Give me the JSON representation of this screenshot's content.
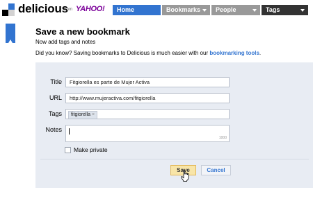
{
  "header": {
    "brand": "delicious",
    "from_label": "from",
    "partner_logo": "YAHOO!",
    "nav": [
      {
        "label": "Home"
      },
      {
        "label": "Bookmarks"
      },
      {
        "label": "People"
      },
      {
        "label": "Tags"
      }
    ]
  },
  "page": {
    "title": "Save a new bookmark",
    "subtitle": "Now add tags and notes",
    "tip_text": "Did you know? Saving bookmarks to Delicious is much easier with our ",
    "tip_link": "bookmarking tools",
    "tip_end": "."
  },
  "form": {
    "title_label": "Title",
    "title_value": "Fitgiorella es parte de Mujer Activa",
    "url_label": "URL",
    "url_value": "http://www.mujeractiva.com/fitgiorella",
    "tags_label": "Tags",
    "tags": [
      "fitgiorella"
    ],
    "tag_remove_glyph": "×",
    "notes_label": "Notes",
    "notes_value": "",
    "notes_remaining": "1000",
    "private_label": "Make private",
    "private_checked": false,
    "save_label": "Save",
    "cancel_label": "Cancel"
  },
  "colors": {
    "accent": "#3274d0",
    "nav_inactive": "#999999",
    "nav_dark": "#333333",
    "panel_bg": "#e8ecf3",
    "save_bg": "#f8e5a8"
  },
  "icons": {
    "logo": "delicious-logo-icon",
    "bookmark": "bookmark-icon",
    "dropdown": "chevron-down-icon",
    "pointer": "hand-pointer-icon"
  }
}
